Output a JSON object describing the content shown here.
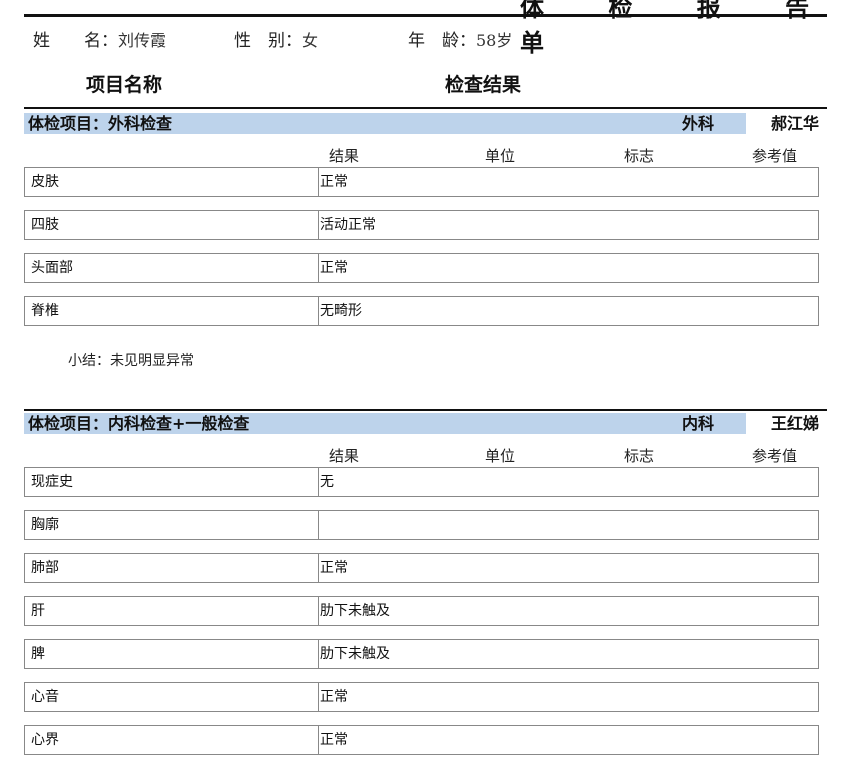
{
  "report": {
    "title_partial": "体 检 报 告 单"
  },
  "patient": {
    "name_label": "姓　　名：",
    "name_value": "刘传霞",
    "sex_label": "性　别：",
    "sex_value": "女",
    "age_label": "年　龄：",
    "age_value": "58岁"
  },
  "columns": {
    "item_name": "项目名称",
    "result": "检查结果"
  },
  "table_header": {
    "result": "结果",
    "unit": "单位",
    "flag": "标志",
    "reference": "参考值"
  },
  "sections": [
    {
      "label": "体检项目：外科检查",
      "department": "外科",
      "doctor": "郝江华",
      "rows": [
        {
          "name": "皮肤",
          "result": "正常"
        },
        {
          "name": "四肢",
          "result": "活动正常"
        },
        {
          "name": "头面部",
          "result": "正常"
        },
        {
          "name": "脊椎",
          "result": "无畸形"
        }
      ],
      "summary": "小结：未见明显异常"
    },
    {
      "label": "体检项目：内科检查+一般检查",
      "department": "内科",
      "doctor": "王红娣",
      "rows": [
        {
          "name": "现症史",
          "result": "无"
        },
        {
          "name": "胸廓",
          "result": ""
        },
        {
          "name": "肺部",
          "result": "正常"
        },
        {
          "name": "肝",
          "result": "肋下未触及"
        },
        {
          "name": "脾",
          "result": "肋下未触及"
        },
        {
          "name": "心音",
          "result": "正常"
        },
        {
          "name": "心界",
          "result": "正常"
        }
      ]
    }
  ]
}
